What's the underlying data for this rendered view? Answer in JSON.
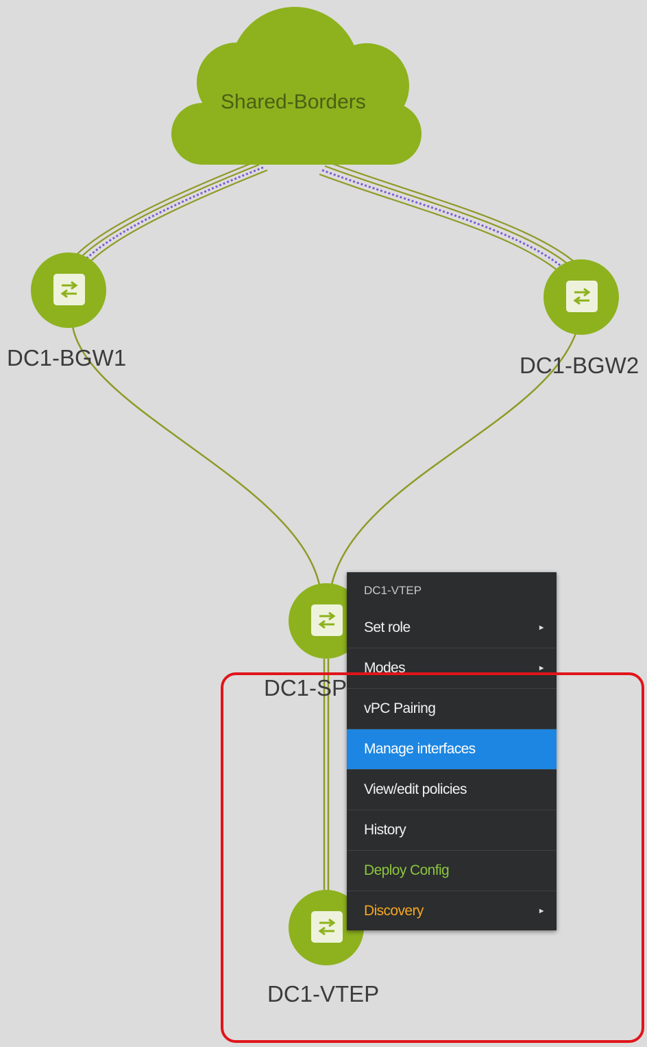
{
  "cloud": {
    "label": "Shared-Borders",
    "color": "#8db21e"
  },
  "nodes": {
    "bgw1": {
      "label": "DC1-BGW1",
      "icon": "switch-icon"
    },
    "bgw2": {
      "label": "DC1-BGW2",
      "icon": "switch-icon"
    },
    "spine": {
      "label": "DC1-SP",
      "icon": "switch-icon"
    },
    "vtep": {
      "label": "DC1-VTEP",
      "icon": "switch-icon"
    }
  },
  "colors": {
    "node": "#8db21e",
    "link": "#8f9a27",
    "link_dashed": "#7b5cd6",
    "menu_background": "#2b2d2e",
    "menu_active": "#1d86e2",
    "menu_deploy": "#8cc63f",
    "menu_discovery": "#f5a623",
    "highlight": "#e0151b"
  },
  "context_menu": {
    "header": "DC1-VTEP",
    "items": [
      {
        "label": "Set role",
        "has_submenu": true
      },
      {
        "label": "Modes",
        "has_submenu": true
      },
      {
        "label": "vPC Pairing",
        "has_submenu": false
      },
      {
        "label": "Manage interfaces",
        "has_submenu": false,
        "active": true
      },
      {
        "label": "View/edit policies",
        "has_submenu": false
      },
      {
        "label": "History",
        "has_submenu": false
      },
      {
        "label": "Deploy Config",
        "has_submenu": false
      },
      {
        "label": "Discovery",
        "has_submenu": true
      }
    ],
    "submenu_glyph": "►"
  }
}
